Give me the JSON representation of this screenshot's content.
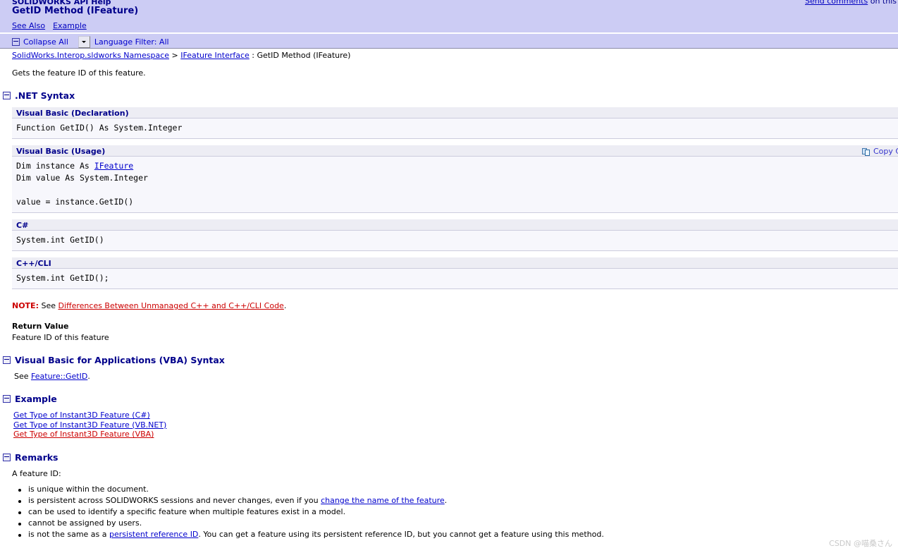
{
  "header": {
    "app_title": "SOLIDWORKS API Help",
    "page_title": "GetID Method (IFeature)",
    "see_also": "See Also",
    "example_link": "Example",
    "send_comments_link": "Send comments",
    "send_comments_suffix": " on this"
  },
  "toolbar": {
    "collapse_all": "Collapse All",
    "language_filter": "Language Filter: All",
    "collapse_icon": "minus-box-icon",
    "dropdown_icon": "chevron-down-icon"
  },
  "breadcrumb": {
    "namespace": "SolidWorks.Interop.sldworks Namespace",
    "separator_1": " > ",
    "interface": "IFeature Interface",
    "separator_2": " : ",
    "current": "GetID Method (IFeature)"
  },
  "summary": "Gets the feature ID of this feature.",
  "sections": {
    "net_syntax": {
      "title": ".NET Syntax",
      "blocks": [
        {
          "lang": "Visual Basic (Declaration)",
          "code": "Function GetID() As System.Integer",
          "copy_label": null
        },
        {
          "lang": "Visual Basic (Usage)",
          "copy_label": "Copy C",
          "code_line_1": "Dim instance As ",
          "code_link": "IFeature",
          "code_line_2": "Dim value As System.Integer",
          "code_line_3": "",
          "code_line_4": "value = instance.GetID()"
        },
        {
          "lang": "C#",
          "code": "System.int GetID()",
          "copy_label": null
        },
        {
          "lang": "C++/CLI",
          "code": "System.int GetID();",
          "copy_label": null
        }
      ],
      "note_label": "NOTE:",
      "note_text_before": " See ",
      "note_link": "Differences Between Unmanaged C++ and C++/CLI Code",
      "note_text_after": ".",
      "return_value_heading": "Return Value",
      "return_value_text": "Feature ID of this feature"
    },
    "vba_syntax": {
      "title": "Visual Basic for Applications (VBA) Syntax",
      "see_prefix": "See ",
      "link": "Feature::GetID",
      "suffix": "."
    },
    "example": {
      "title": "Example",
      "links": [
        {
          "label": "Get Type of Instant3D Feature (C#)",
          "visited": false
        },
        {
          "label": "Get Type of Instant3D Feature (VB.NET)",
          "visited": false
        },
        {
          "label": "Get Type of Instant3D Feature (VBA)",
          "visited": true
        }
      ]
    },
    "remarks": {
      "title": "Remarks",
      "intro": "A feature ID:",
      "bullets": [
        {
          "text_1": "is unique within the document.",
          "link": null,
          "text_2": null
        },
        {
          "text_1": "is persistent across SOLIDWORKS sessions and never changes, even if you ",
          "link": "change the name of the feature",
          "text_2": "."
        },
        {
          "text_1": "can be used to identify a specific feature when multiple features exist in a model.",
          "link": null,
          "text_2": null
        },
        {
          "text_1": "cannot be assigned by users.",
          "link": null,
          "text_2": null
        },
        {
          "text_1": "is not the same as a ",
          "link": "persistent reference ID",
          "text_2": ". You can get a feature using its persistent reference ID, but you cannot get a feature using this method."
        }
      ]
    }
  },
  "watermark": "CSDN @喵桑さん",
  "colors": {
    "header_band": "#ccccf4",
    "heading_blue": "#00008b",
    "link_blue": "#0000cc",
    "visited_red": "#cc0000",
    "code_header_bg": "#ededf4",
    "code_body_bg": "#f7f7fc"
  }
}
